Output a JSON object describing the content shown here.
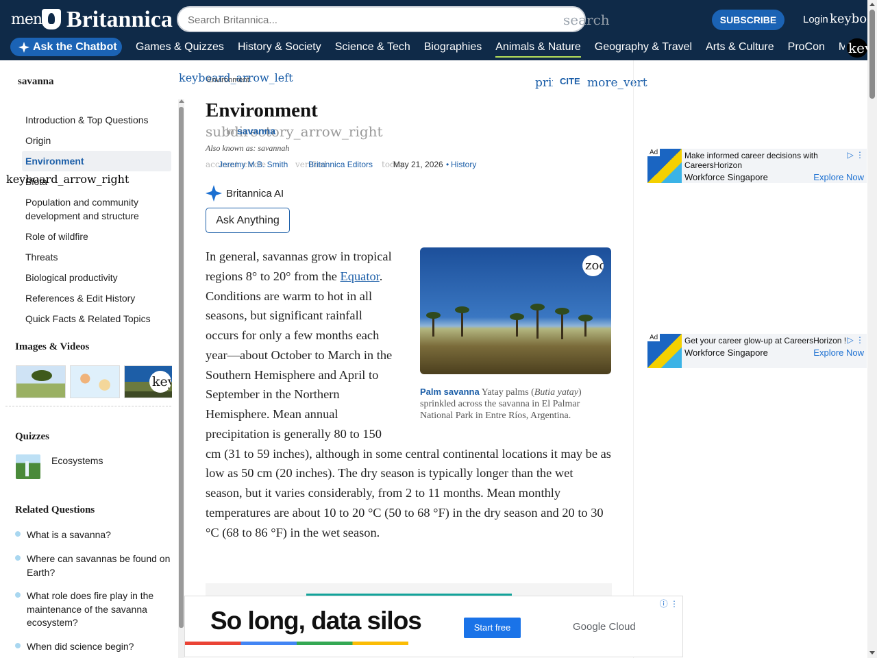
{
  "header": {
    "menu_glyph": "menu",
    "logo_text": "Britannica",
    "search_placeholder": "Search Britannica...",
    "search_glyph": "search",
    "subscribe_label": "SUBSCRIBE",
    "login_label": "Login",
    "login_glyph": "keyboard_arrow_down",
    "chatbot_label": "Ask the Chatbot",
    "nav": [
      "Games & Quizzes",
      "History & Society",
      "Science & Tech",
      "Biographies",
      "Animals & Nature",
      "Geography & Travel",
      "Arts & Culture",
      "ProCon",
      "Money"
    ],
    "nav_active": "Animals & Nature",
    "nav_more_glyph": "keyboard_arrow_right",
    "colors": {
      "bar": "#0f2a48",
      "accent": "#1b63b5",
      "active_underline": "#b6e05a"
    }
  },
  "sidebar": {
    "title": "savanna",
    "toc": [
      "Introduction & Top Questions",
      "Origin",
      "Environment",
      "Biota",
      "Population and community development and structure",
      "Role of wildfire",
      "Threats",
      "Biological productivity",
      "References & Edit History",
      "Quick Facts & Related Topics"
    ],
    "toc_active": "Environment",
    "toc_expand_glyph": "keyboard_arrow_right",
    "images_heading": "Images & Videos",
    "thumbs_more_glyph": "keyboard_arrow_right",
    "quizzes_heading": "Quizzes",
    "quiz_item": "Ecosystems",
    "related_heading": "Related Questions",
    "related_questions": [
      "What is a savanna?",
      "Where can savannas be found on Earth?",
      "What role does fire play in the maintenance of the savanna ecosystem?",
      "When did science begin?"
    ]
  },
  "article": {
    "back_glyph": "keyboard_arrow_left",
    "breadcrumb": "Environment",
    "print_glyph": "print",
    "cite_label": "CITE",
    "more_glyph": "more_vert",
    "title": "Environment",
    "subdirectory_glyph": "subdirectory_arrow_right",
    "in_label": "In",
    "parent_link": "savanna",
    "also_known": "Also known as: savannah",
    "byline_account_glyph": "account_circle",
    "author": "Jeremy M.B. Smith",
    "verified_glyph": "verified",
    "editors": "Britannica Editors",
    "today_glyph": "today",
    "date": "May 21, 2026",
    "separator": "•",
    "history_link": "History",
    "ai_label": "Britannica AI",
    "ask_label": "Ask Anything",
    "paragraph_before_link": "In general, savannas grow in tropical regions 8° to 20° from the ",
    "paragraph_link": "Equator",
    "paragraph_after_link": ". Conditions are warm to hot in all seasons, but significant rainfall occurs for only a few months each year—about October to March in the Southern Hemisphere and April to September in the Northern Hemisphere. Mean annual precipitation is generally 80 to 150 cm (31 to 59 inches), although in some central continental locations it may be as low as 50 cm (20 inches). The dry season is typically longer than the wet season, but it varies considerably, from 2 to 11 months. Mean monthly temperatures are about 10 to 20 °C (50 to 68 °F) in the dry season and 20 to 30 °C (68 to 86 °F) in the wet season.",
    "figure": {
      "zoom_glyph": "zoom_in",
      "caption_title": "Palm savanna",
      "caption_text_1": " Yatay palms (",
      "caption_italic": "Butia yatay",
      "caption_text_2": ") sprinkled across the savanna in El Palmar National Park in Entre Ríos, Argentina."
    }
  },
  "ads": {
    "badge": "Ad",
    "ad1_line1": "Make informed career decisions with",
    "ad1_line2": "CareersHorizon",
    "ad1_brand": "Workforce Singapore",
    "ad1_cta": "Explore Now",
    "ad2_line1": "Get your career glow-up at CareersHorizon !",
    "ad2_brand": "Workforce Singapore",
    "ad2_cta": "Explore Now",
    "bottom_headline": "So long, data silos",
    "bottom_cta": "Start free",
    "bottom_brand": "Google Cloud"
  }
}
